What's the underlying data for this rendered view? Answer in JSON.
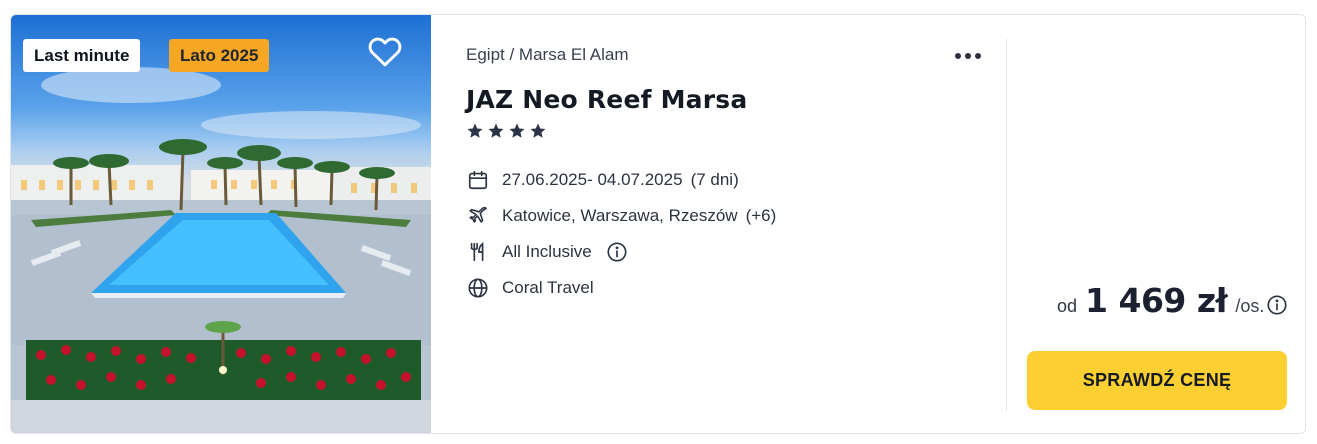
{
  "offer": {
    "badges": {
      "last_minute": "Last minute",
      "season": "Lato 2025"
    },
    "favorite_icon": "heart-outline-icon",
    "breadcrumb": "Egipt / Marsa El Alam",
    "more_icon": "more-dots-icon",
    "hotel_name": "JAZ Neo Reef Marsa",
    "stars": 4,
    "dates": {
      "range": "27.06.2025- 04.07.2025",
      "duration": "(7 dni)",
      "icon": "calendar-icon"
    },
    "departures": {
      "cities": "Katowice, Warszawa, Rzeszów",
      "more": "(+6)",
      "icon": "plane-icon"
    },
    "board": {
      "label": "All Inclusive",
      "icon": "food-icon",
      "info_icon": "info-icon"
    },
    "operator": {
      "label": "Coral Travel",
      "icon": "globe-icon"
    },
    "price": {
      "prefix": "od",
      "amount": "1 469 zł",
      "unit": "/os.",
      "info_icon": "info-icon"
    },
    "cta_label": "SPRAWDŹ CENĘ"
  },
  "colors": {
    "accent_yellow": "#fdcf30",
    "season_badge": "#f5a623",
    "text_dark": "#1d2430",
    "star_color": "#2b3346"
  }
}
